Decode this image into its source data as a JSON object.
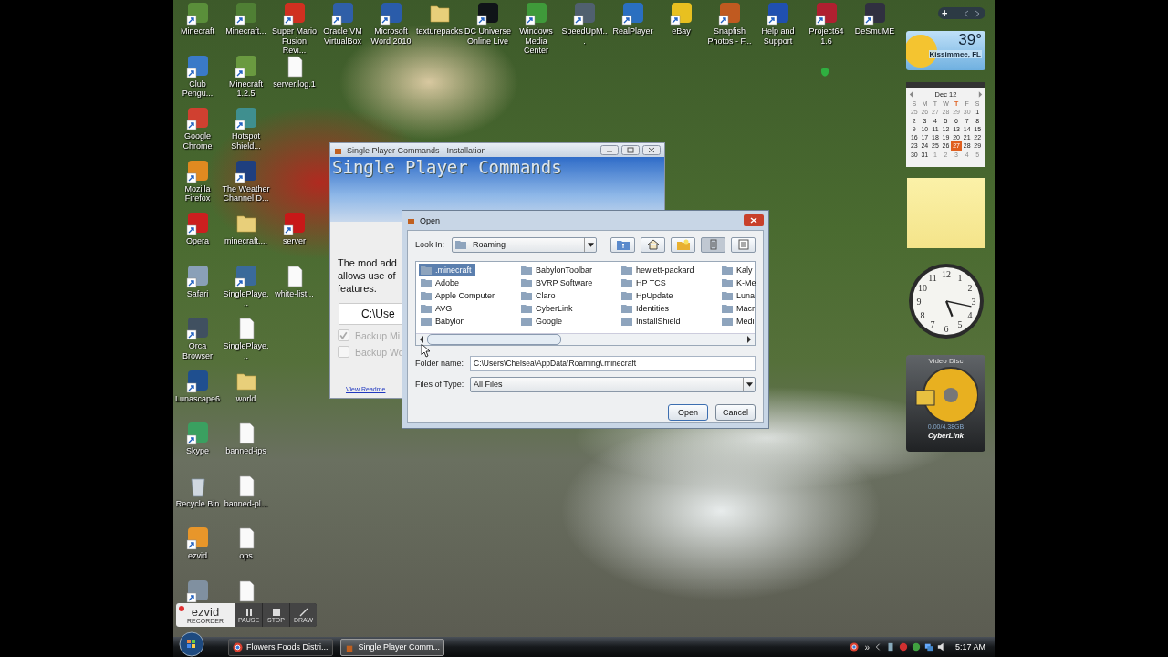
{
  "desktop": {
    "icon_columns": [
      [
        {
          "label": "Minecraft",
          "kind": "app",
          "color": "#5a8f3a"
        },
        {
          "label": "Club Pengu...",
          "kind": "app",
          "color": "#3a7ac8"
        },
        {
          "label": "Google Chrome",
          "kind": "app",
          "color": "#d04030"
        },
        {
          "label": "Mozilla Firefox",
          "kind": "app",
          "color": "#e08a20"
        },
        {
          "label": "Opera",
          "kind": "app",
          "color": "#cc1f1f"
        },
        {
          "label": "Safari",
          "kind": "app",
          "color": "#8aa0b8"
        },
        {
          "label": "Orca Browser",
          "kind": "app",
          "color": "#405060"
        },
        {
          "label": "Lunascape6",
          "kind": "app",
          "color": "#1f4f8f"
        },
        {
          "label": "Skype",
          "kind": "app",
          "color": "#3aa060"
        },
        {
          "label": "Recycle Bin",
          "kind": "bin"
        },
        {
          "label": "ezvid",
          "kind": "app",
          "color": "#e8962a"
        },
        {
          "kind": "app",
          "color": "#8090a0"
        }
      ],
      [
        {
          "label": "Minecraft...",
          "kind": "app",
          "color": "#4f7f34"
        },
        {
          "label": "Minecraft 1.2.5",
          "kind": "app",
          "color": "#6a9a40"
        },
        {
          "label": "Hotspot Shield...",
          "kind": "app",
          "color": "#3f8f8f"
        },
        {
          "label": "The Weather Channel D...",
          "kind": "app",
          "color": "#1f3f7f"
        },
        {
          "label": "minecraft....",
          "kind": "folder"
        },
        {
          "label": "SinglePlaye...",
          "kind": "app",
          "color": "#3a6a9a"
        },
        {
          "label": "SinglePlaye...",
          "kind": "file"
        },
        {
          "label": "world",
          "kind": "folder"
        },
        {
          "label": "banned-ips",
          "kind": "file"
        },
        {
          "label": "banned-pl...",
          "kind": "file"
        },
        {
          "label": "ops",
          "kind": "file"
        },
        {
          "kind": "file"
        }
      ],
      [
        {
          "label": "Super Mario Fusion Revi...",
          "kind": "app",
          "color": "#d03020"
        },
        {
          "label": "server.log.1",
          "kind": "file"
        },
        null,
        null,
        {
          "label": "server",
          "kind": "app",
          "color": "#c81818"
        },
        {
          "label": "white-list...",
          "kind": "file"
        }
      ],
      [
        {
          "label": "Oracle VM VirtualBox",
          "kind": "app",
          "color": "#2f5fa8"
        }
      ],
      [
        {
          "label": "Microsoft Word 2010",
          "kind": "app",
          "color": "#2a5caa"
        }
      ],
      [
        {
          "label": "texturepacks",
          "kind": "folder"
        }
      ],
      [
        {
          "label": "DC Universe Online Live",
          "kind": "app",
          "color": "#101418"
        }
      ],
      [
        {
          "label": "Windows Media Center",
          "kind": "app",
          "color": "#3f9a3a"
        }
      ],
      [
        {
          "label": "SpeedUpM...",
          "kind": "app",
          "color": "#50606f"
        }
      ],
      [
        {
          "label": "RealPlayer",
          "kind": "app",
          "color": "#2a6fc0"
        }
      ],
      [
        {
          "label": "eBay",
          "kind": "app",
          "color": "#e8c020"
        }
      ],
      [
        {
          "label": "Snapfish Photos - F...",
          "kind": "app",
          "color": "#c05a20"
        }
      ],
      [
        {
          "label": "Help and Support",
          "kind": "app",
          "color": "#2050b0"
        }
      ],
      [
        {
          "label": "Project64 1.6",
          "kind": "app",
          "color": "#b02030"
        }
      ],
      [
        {
          "label": "DeSmuME",
          "kind": "app",
          "color": "#303040"
        }
      ]
    ]
  },
  "gadgets": {
    "add": "+",
    "weather": {
      "temperature": "39°",
      "location": "Kissimmee, FL"
    },
    "calendar": {
      "month": "Dec 12",
      "weekdays": [
        {
          "text": "S",
          "today": false
        },
        {
          "text": "M",
          "today": false
        },
        {
          "text": "T",
          "today": false
        },
        {
          "text": "W",
          "today": false
        },
        {
          "text": "T",
          "today": true
        },
        {
          "text": "F",
          "today": false
        },
        {
          "text": "S",
          "today": false
        }
      ],
      "days": [
        {
          "text": "25",
          "muted": true,
          "selected": false
        },
        {
          "text": "26",
          "muted": true,
          "selected": false
        },
        {
          "text": "27",
          "muted": true,
          "selected": false
        },
        {
          "text": "28",
          "muted": true,
          "selected": false
        },
        {
          "text": "29",
          "muted": true,
          "selected": false
        },
        {
          "text": "30",
          "muted": true,
          "selected": false
        },
        {
          "text": "1",
          "muted": false,
          "selected": false
        },
        {
          "text": "2",
          "muted": false,
          "selected": false
        },
        {
          "text": "3",
          "muted": false,
          "selected": false
        },
        {
          "text": "4",
          "muted": false,
          "selected": false
        },
        {
          "text": "5",
          "muted": false,
          "selected": false
        },
        {
          "text": "6",
          "muted": false,
          "selected": false
        },
        {
          "text": "7",
          "muted": false,
          "selected": false
        },
        {
          "text": "8",
          "muted": false,
          "selected": false
        },
        {
          "text": "9",
          "muted": false,
          "selected": false
        },
        {
          "text": "10",
          "muted": false,
          "selected": false
        },
        {
          "text": "11",
          "muted": false,
          "selected": false
        },
        {
          "text": "12",
          "muted": false,
          "selected": false
        },
        {
          "text": "13",
          "muted": false,
          "selected": false
        },
        {
          "text": "14",
          "muted": false,
          "selected": false
        },
        {
          "text": "15",
          "muted": false,
          "selected": false
        },
        {
          "text": "16",
          "muted": false,
          "selected": false
        },
        {
          "text": "17",
          "muted": false,
          "selected": false
        },
        {
          "text": "18",
          "muted": false,
          "selected": false
        },
        {
          "text": "19",
          "muted": false,
          "selected": false
        },
        {
          "text": "20",
          "muted": false,
          "selected": false
        },
        {
          "text": "21",
          "muted": false,
          "selected": false
        },
        {
          "text": "22",
          "muted": false,
          "selected": false
        },
        {
          "text": "23",
          "muted": false,
          "selected": false
        },
        {
          "text": "24",
          "muted": false,
          "selected": false
        },
        {
          "text": "25",
          "muted": false,
          "selected": false
        },
        {
          "text": "26",
          "muted": false,
          "selected": false
        },
        {
          "text": "27",
          "muted": false,
          "selected": true
        },
        {
          "text": "28",
          "muted": false,
          "selected": false
        },
        {
          "text": "29",
          "muted": false,
          "selected": false
        },
        {
          "text": "30",
          "muted": false,
          "selected": false
        },
        {
          "text": "31",
          "muted": false,
          "selected": false
        },
        {
          "text": "1",
          "muted": true,
          "selected": false
        },
        {
          "text": "2",
          "muted": true,
          "selected": false
        },
        {
          "text": "3",
          "muted": true,
          "selected": false
        },
        {
          "text": "4",
          "muted": true,
          "selected": false
        },
        {
          "text": "5",
          "muted": true,
          "selected": false
        }
      ]
    },
    "clock": {
      "numerals": [
        "12",
        "1",
        "2",
        "3",
        "4",
        "5",
        "6",
        "7",
        "8",
        "9",
        "10",
        "11"
      ]
    },
    "video_disc": {
      "title": "Video Disc",
      "capacity": "0.00/4.38GB",
      "brand": "CyberLink"
    }
  },
  "installer_window": {
    "title": "Single Player Commands - Installation",
    "banner_title": "Single Player Commands",
    "description_lines": [
      "The mod add",
      "allows use of",
      "features."
    ],
    "path_field": "C:\\Use",
    "options": [
      {
        "label": "Backup Mi",
        "checked": true
      },
      {
        "label": "Backup Wo",
        "checked": false
      }
    ],
    "readme_link": "View Readme"
  },
  "open_dialog": {
    "title": "Open",
    "look_in_label": "Look In:",
    "look_in_value": "Roaming",
    "toolbar": [
      {
        "kind": "up",
        "selected": false
      },
      {
        "kind": "home",
        "selected": false
      },
      {
        "kind": "new-folder",
        "selected": false
      },
      {
        "kind": "list",
        "selected": true
      },
      {
        "kind": "details",
        "selected": false
      }
    ],
    "files": [
      {
        "name": ".minecraft",
        "selected": true
      },
      {
        "name": "Adobe",
        "selected": false
      },
      {
        "name": "Apple Computer",
        "selected": false
      },
      {
        "name": "AVG",
        "selected": false
      },
      {
        "name": "Babylon",
        "selected": false
      },
      {
        "name": "BabylonToolbar",
        "selected": false
      },
      {
        "name": "BVRP Software",
        "selected": false
      },
      {
        "name": "Claro",
        "selected": false
      },
      {
        "name": "CyberLink",
        "selected": false
      },
      {
        "name": "Google",
        "selected": false
      },
      {
        "name": "hewlett-packard",
        "selected": false
      },
      {
        "name": "HP TCS",
        "selected": false
      },
      {
        "name": "HpUpdate",
        "selected": false
      },
      {
        "name": "Identities",
        "selected": false
      },
      {
        "name": "InstallShield",
        "selected": false
      },
      {
        "name": "Kaly",
        "selected": false
      },
      {
        "name": "K-Me",
        "selected": false
      },
      {
        "name": "Luna",
        "selected": false
      },
      {
        "name": "Macr",
        "selected": false
      },
      {
        "name": "Medi",
        "selected": false
      }
    ],
    "folder_name_label": "Folder name:",
    "folder_name_value": "C:\\Users\\Chelsea\\AppData\\Roaming\\.minecraft",
    "file_type_label": "Files of Type:",
    "file_type_value": "All Files",
    "buttons": [
      {
        "label": "Open",
        "kind": "default"
      },
      {
        "label": "Cancel",
        "kind": "normal"
      }
    ]
  },
  "recorder": {
    "logo": "ezvid",
    "subtitle": "RECORDER",
    "buttons": [
      {
        "label": "PAUSE",
        "kind": "pause"
      },
      {
        "label": "STOP",
        "kind": "stop"
      },
      {
        "label": "DRAW",
        "kind": "draw"
      }
    ]
  },
  "taskbar": {
    "tasks": [
      {
        "label": "Flowers Foods Distri...",
        "kind": "browser",
        "selected": false
      },
      {
        "label": "Single Player Comm...",
        "kind": "java",
        "selected": true
      }
    ],
    "overflow": "»",
    "time": "5:17 AM"
  }
}
